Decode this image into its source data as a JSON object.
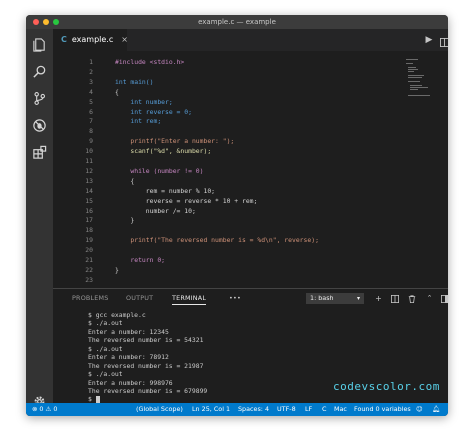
{
  "window": {
    "title": "example.c — example"
  },
  "traffic_lights": [
    "#ff5f57",
    "#febc2e",
    "#28c840"
  ],
  "activity_bar": [
    "files-icon",
    "search-icon",
    "source-control-icon",
    "debug-icon",
    "extensions-icon",
    "settings-gear-icon"
  ],
  "tab": {
    "lang_icon": "C",
    "filename": "example.c",
    "close": "×"
  },
  "editor_actions": [
    "run-icon",
    "split-editor-icon",
    "more-actions-icon"
  ],
  "code": {
    "line_numbers": [
      "1",
      "2",
      "3",
      "4",
      "5",
      "6",
      "7",
      "8",
      "9",
      "10",
      "11",
      "12",
      "13",
      "14",
      "15",
      "16",
      "17",
      "18",
      "19",
      "20",
      "21",
      "22",
      "23"
    ],
    "lines": [
      "#include <stdio.h>",
      "",
      "int main()",
      "{",
      "    int number;",
      "    int reverse = 0;",
      "    int rem;",
      "",
      "    printf(\"Enter a number: \");",
      "    scanf(\"%d\", &number);",
      "",
      "    while (number != 0)",
      "    {",
      "        rem = number % 10;",
      "        reverse = reverse * 10 + rem;",
      "        number /= 10;",
      "    }",
      "",
      "    printf(\"The reversed number is = %d\\n\", reverse);",
      "",
      "    return 0;",
      "}",
      ""
    ]
  },
  "panel": {
    "tabs": [
      "PROBLEMS",
      "OUTPUT",
      "TERMINAL"
    ],
    "active_tab": "TERMINAL",
    "more": "•••",
    "terminal_select": "1: bash",
    "icons": [
      "add-terminal-icon",
      "split-terminal-icon",
      "trash-icon",
      "maximize-panel-icon",
      "close-panel-icon"
    ],
    "terminal_lines": [
      "$ gcc example.c",
      "$ ./a.out",
      "Enter a number: 12345",
      "The reversed number is = 54321",
      "$ ./a.out",
      "Enter a number: 78912",
      "The reversed number is = 21987",
      "$ ./a.out",
      "Enter a number: 998976",
      "The reversed number is = 679899",
      "$ "
    ]
  },
  "watermark": "codevscolor.com",
  "status_bar": {
    "errors": "0",
    "warnings": "0",
    "scope": "(Global Scope)",
    "position": "Ln 25, Col 1",
    "spaces": "Spaces: 4",
    "encoding": "UTF-8",
    "eol": "LF",
    "language": "C",
    "platform": "Mac",
    "variables": "Found 0 variables",
    "color": "#007acc"
  }
}
